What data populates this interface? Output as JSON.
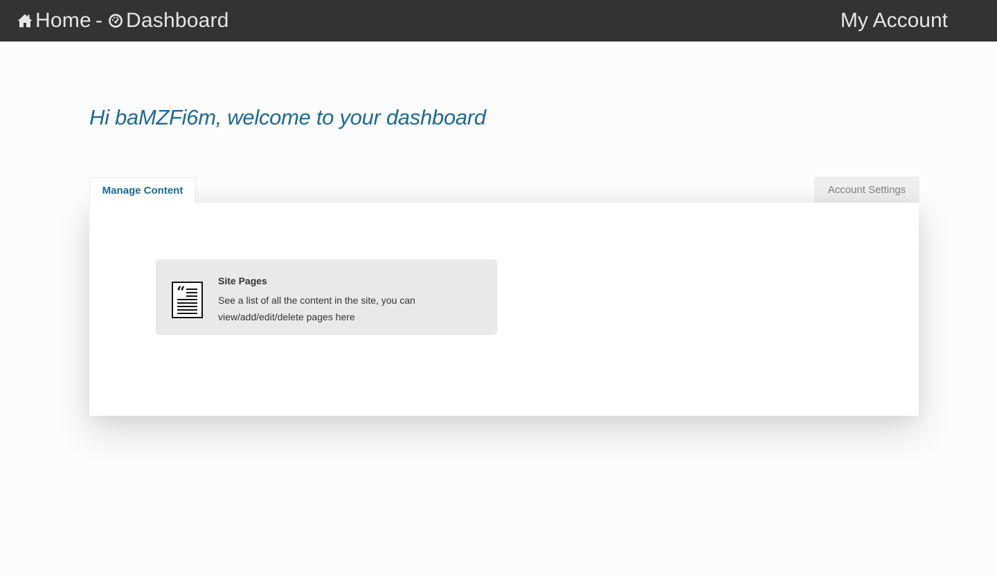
{
  "header": {
    "home_label": "Home",
    "separator": "-",
    "dashboard_label": "Dashboard",
    "account_label": "My Account",
    "home_icon": "home-icon",
    "dashboard_icon": "dashboard-icon",
    "background_color": "#333333"
  },
  "welcome": {
    "text": "Hi baMZFi6m, welcome to your dashboard",
    "color": "#1c6a93"
  },
  "tabs": [
    {
      "label": "Manage Content",
      "active": true
    },
    {
      "label": "Account Settings",
      "active": false
    }
  ],
  "cards": [
    {
      "icon": "page-document-icon",
      "title": "Site Pages",
      "description": "See a list of all the content in the site, you can view/add/edit/delete pages here"
    }
  ]
}
